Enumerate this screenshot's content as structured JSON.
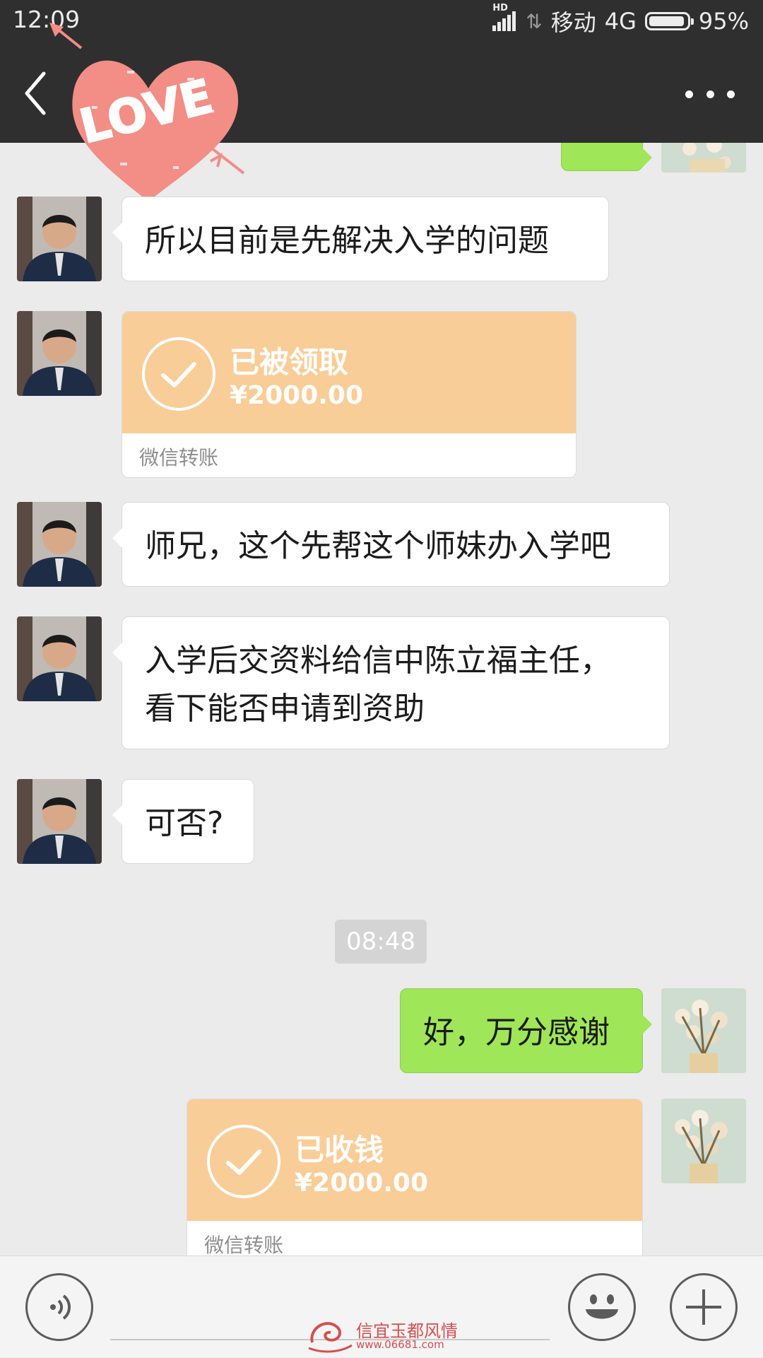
{
  "status_bar": {
    "time": "12:09",
    "network_badge": "HD",
    "carrier": "移动",
    "network": "4G",
    "battery": "95%",
    "battery_level": 0.95
  },
  "header": {
    "back_icon": "chevron-left-icon",
    "more_icon": "more-horizontal-icon",
    "sticker_text": "LOVE"
  },
  "messages": [
    {
      "side": "left",
      "type": "text",
      "text": "所以目前是先解决入学的问题"
    },
    {
      "side": "left",
      "type": "transfer",
      "status": "已被领取",
      "amount": "¥2000.00",
      "label": "微信转账"
    },
    {
      "side": "left",
      "type": "text",
      "text": "师兄，这个先帮这个师妹办入学吧"
    },
    {
      "side": "left",
      "type": "text",
      "lines": [
        "入学后交资料给信中陈立福主任，",
        "看下能否申请到资助"
      ]
    },
    {
      "side": "left",
      "type": "text",
      "text": "可否?"
    },
    {
      "type": "timestamp",
      "text": "08:48"
    },
    {
      "side": "right",
      "type": "text",
      "text": "好，万分感谢"
    },
    {
      "side": "right",
      "type": "transfer",
      "status": "已收钱",
      "amount": "¥2000.00",
      "label": "微信转账"
    }
  ],
  "input_bar": {
    "voice_icon": "voice-icon",
    "emoji_icon": "emoji-icon",
    "plus_icon": "plus-icon"
  },
  "watermark": {
    "text": "信宜玉都风情",
    "url": "www.06681.com"
  },
  "colors": {
    "topbar": "#2f2f2f",
    "chat_background": "#ebebeb",
    "sent_bubble": "#9fe658",
    "transfer_card": "#f9cd98"
  }
}
